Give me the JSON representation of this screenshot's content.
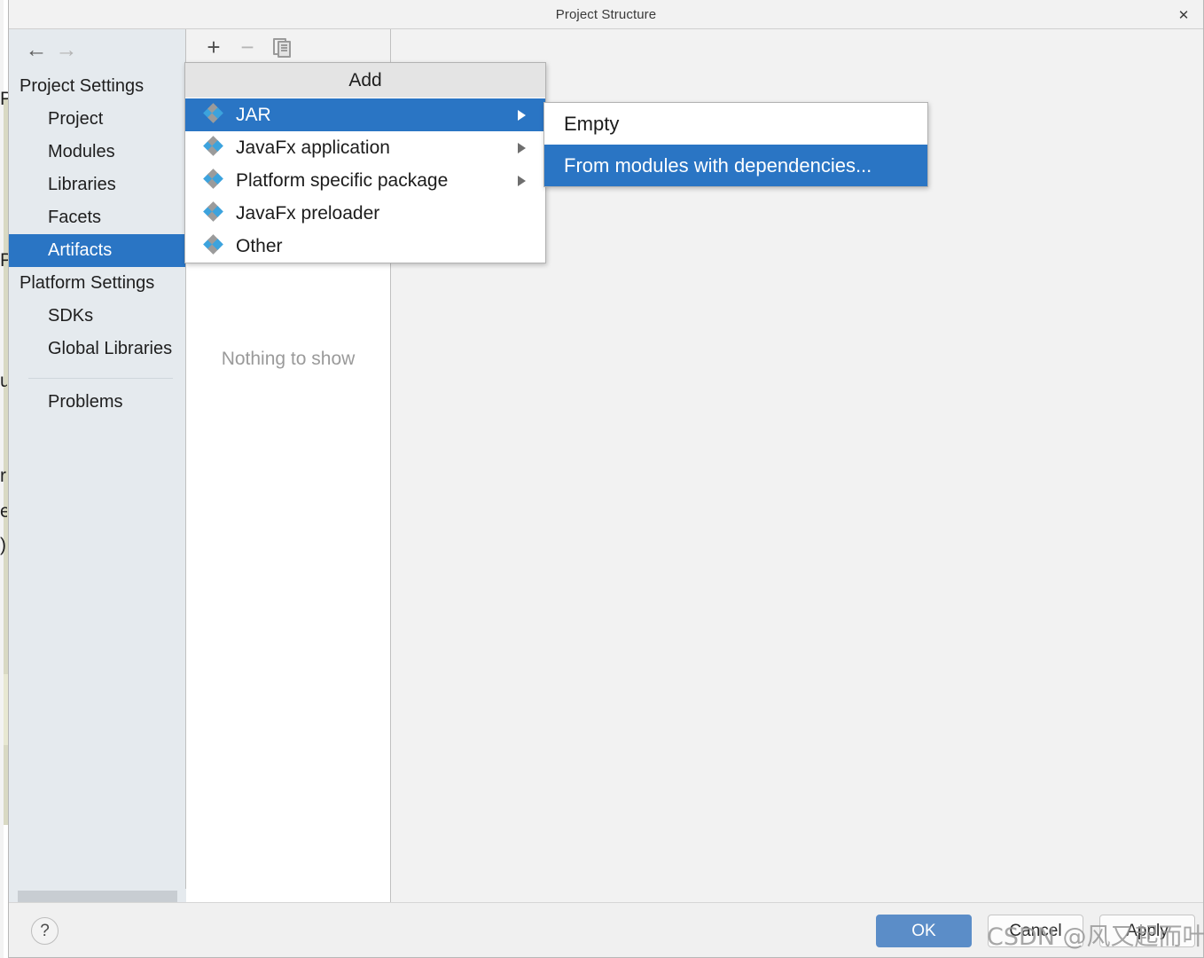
{
  "window": {
    "title": "Project Structure",
    "close_icon": "close-icon",
    "close_glyph": "✕"
  },
  "sidebar": {
    "back_icon": "arrow-left-icon",
    "back_glyph": "←",
    "forward_icon": "arrow-right-icon",
    "forward_glyph": "→",
    "groups": [
      {
        "label": "Project Settings",
        "items": [
          {
            "label": "Project",
            "selected": false
          },
          {
            "label": "Modules",
            "selected": false
          },
          {
            "label": "Libraries",
            "selected": false
          },
          {
            "label": "Facets",
            "selected": false
          },
          {
            "label": "Artifacts",
            "selected": true
          }
        ]
      },
      {
        "label": "Platform Settings",
        "items": [
          {
            "label": "SDKs",
            "selected": false
          },
          {
            "label": "Global Libraries",
            "selected": false
          }
        ]
      }
    ],
    "problems_label": "Problems"
  },
  "toolbar": {
    "add_icon": "plus-icon",
    "add_glyph": "+",
    "remove_icon": "minus-icon",
    "remove_glyph": "−",
    "copy_icon": "copy-icon"
  },
  "mid_panel": {
    "empty_text": "Nothing to show"
  },
  "menu": {
    "title": "Add",
    "items": [
      {
        "label": "JAR",
        "icon": "diamond-cluster-icon",
        "has_submenu": true,
        "selected": true
      },
      {
        "label": "JavaFx application",
        "icon": "diamond-cluster-icon",
        "has_submenu": true,
        "selected": false
      },
      {
        "label": "Platform specific package",
        "icon": "diamond-cluster-icon",
        "has_submenu": true,
        "selected": false
      },
      {
        "label": "JavaFx preloader",
        "icon": "diamond-cluster-icon",
        "has_submenu": false,
        "selected": false
      },
      {
        "label": "Other",
        "icon": "diamond-cluster-icon",
        "has_submenu": false,
        "selected": false
      }
    ]
  },
  "submenu": {
    "items": [
      {
        "label": "Empty",
        "selected": false
      },
      {
        "label": "From modules with dependencies...",
        "selected": true
      }
    ]
  },
  "footer": {
    "help_icon": "question-mark-icon",
    "help_glyph": "?",
    "ok_label": "OK",
    "cancel_label": "Cancel",
    "apply_label": "Apply"
  },
  "watermark": {
    "text": "CSDN @风又起而叶落地"
  },
  "background_bleed": {
    "letters": [
      "P",
      "P",
      "u",
      "r",
      "e",
      ")"
    ]
  },
  "colors": {
    "accent": "#2a75c4",
    "ok_button": "#5b8dc8",
    "sidebar_bg": "#e5eaee",
    "dialog_bg": "#f2f2f2",
    "icon_blue": "#3ca3dd",
    "icon_gray": "#9b9b9b"
  }
}
